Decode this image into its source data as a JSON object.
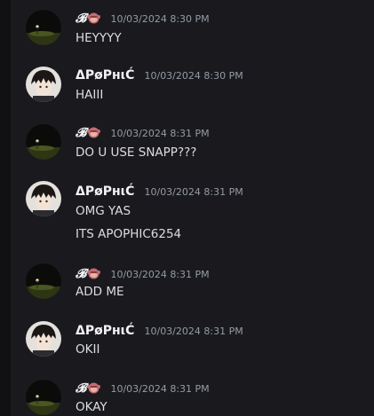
{
  "messages": [
    {
      "author": "𝓑",
      "emoji": "monkey-emoji",
      "time": "10/03/2024 8:30 PM",
      "lines": [
        "HEYYYY"
      ],
      "avatar": "night-street-avatar"
    },
    {
      "author": "ΔPøPнιĆ",
      "time": "10/03/2024 8:30 PM",
      "lines": [
        "HAIII"
      ],
      "avatar": "anime-boy-avatar"
    },
    {
      "author": "𝓑",
      "emoji": "monkey-emoji",
      "time": "10/03/2024 8:31 PM",
      "lines": [
        "DO U USE SNAPP???"
      ],
      "avatar": "night-street-avatar"
    },
    {
      "author": "ΔPøPнιĆ",
      "time": "10/03/2024 8:31 PM",
      "lines": [
        "OMG YAS",
        "ITS APOPHIC6254"
      ],
      "avatar": "anime-boy-avatar"
    },
    {
      "author": "𝓑",
      "emoji": "monkey-emoji",
      "time": "10/03/2024 8:31 PM",
      "lines": [
        "ADD ME"
      ],
      "avatar": "night-street-avatar"
    },
    {
      "author": "ΔPøPнιĆ",
      "time": "10/03/2024 8:31 PM",
      "lines": [
        "OKII"
      ],
      "avatar": "anime-boy-avatar"
    },
    {
      "author": "𝓑",
      "emoji": "monkey-emoji",
      "time": "10/03/2024 8:31 PM",
      "lines": [
        "OKAY"
      ],
      "avatar": "night-street-avatar"
    }
  ],
  "colors": {
    "background": "#1a1a1e",
    "author": "#f2f3f5",
    "timestamp": "#949ba4",
    "text": "#dbdee1"
  }
}
